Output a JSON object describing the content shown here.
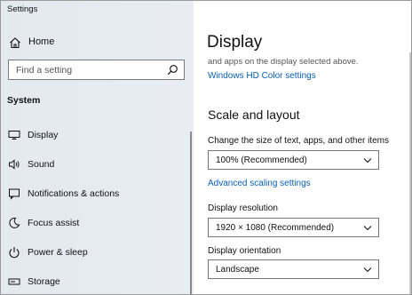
{
  "window": {
    "title": "Settings"
  },
  "sidebar": {
    "home_label": "Home",
    "search_placeholder": "Find a setting",
    "section_label": "System",
    "items": [
      {
        "label": "Display",
        "icon": "monitor-icon"
      },
      {
        "label": "Sound",
        "icon": "speaker-icon"
      },
      {
        "label": "Notifications & actions",
        "icon": "notification-icon"
      },
      {
        "label": "Focus assist",
        "icon": "moon-icon"
      },
      {
        "label": "Power & sleep",
        "icon": "power-icon"
      },
      {
        "label": "Storage",
        "icon": "storage-icon"
      }
    ]
  },
  "main": {
    "title": "Display",
    "truncated_text": "and apps on the display selected above.",
    "hd_color_link": "Windows HD Color settings",
    "scale_section_title": "Scale and layout",
    "scale_label": "Change the size of text, apps, and other items",
    "scale_value": "100% (Recommended)",
    "advanced_scaling_link": "Advanced scaling settings",
    "resolution_label": "Display resolution",
    "resolution_value": "1920 × 1080 (Recommended)",
    "orientation_label": "Display orientation",
    "orientation_value": "Landscape"
  },
  "colors": {
    "sidebar_bg": "#e6ebef",
    "link": "#0a5fb4",
    "text": "#111111"
  }
}
